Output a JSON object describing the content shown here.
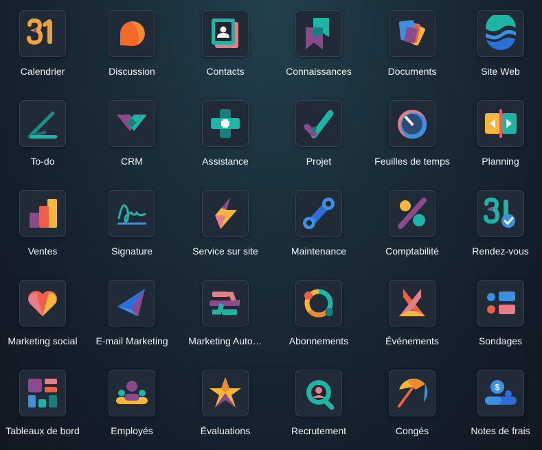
{
  "apps": [
    {
      "label": "Calendrier",
      "icon": "calendar-icon"
    },
    {
      "label": "Discussion",
      "icon": "chat-bubble-icon"
    },
    {
      "label": "Contacts",
      "icon": "contact-card-icon"
    },
    {
      "label": "Connaissances",
      "icon": "bookmark-icon"
    },
    {
      "label": "Documents",
      "icon": "stacked-documents-icon"
    },
    {
      "label": "Site Web",
      "icon": "globe-waves-icon"
    },
    {
      "label": "To-do",
      "icon": "pen-line-icon"
    },
    {
      "label": "CRM",
      "icon": "handshake-icon"
    },
    {
      "label": "Assistance",
      "icon": "medical-cross-icon"
    },
    {
      "label": "Projet",
      "icon": "checkmark-icon"
    },
    {
      "label": "Feuilles de temps",
      "icon": "stopwatch-icon"
    },
    {
      "label": "Planning",
      "icon": "arrows-split-icon"
    },
    {
      "label": "Ventes",
      "icon": "bar-chart-icon"
    },
    {
      "label": "Signature",
      "icon": "signature-icon"
    },
    {
      "label": "Service sur site",
      "icon": "lightning-icon"
    },
    {
      "label": "Maintenance",
      "icon": "wrench-icon"
    },
    {
      "label": "Comptabilité",
      "icon": "percent-icon"
    },
    {
      "label": "Rendez-vous",
      "icon": "calendar-check-icon"
    },
    {
      "label": "Marketing social",
      "icon": "heart-icon"
    },
    {
      "label": "E-mail Marketing",
      "icon": "paper-plane-icon"
    },
    {
      "label": "Marketing Auto…",
      "icon": "automation-flow-icon"
    },
    {
      "label": "Abonnements",
      "icon": "refresh-cycle-icon"
    },
    {
      "label": "Événements",
      "icon": "ribbon-icon"
    },
    {
      "label": "Sondages",
      "icon": "survey-icon"
    },
    {
      "label": "Tableaux de bord",
      "icon": "dashboard-icon"
    },
    {
      "label": "Employés",
      "icon": "people-icon"
    },
    {
      "label": "Évaluations",
      "icon": "star-icon"
    },
    {
      "label": "Recrutement",
      "icon": "search-person-icon"
    },
    {
      "label": "Congés",
      "icon": "umbrella-icon"
    },
    {
      "label": "Notes de frais",
      "icon": "expense-icon"
    }
  ]
}
